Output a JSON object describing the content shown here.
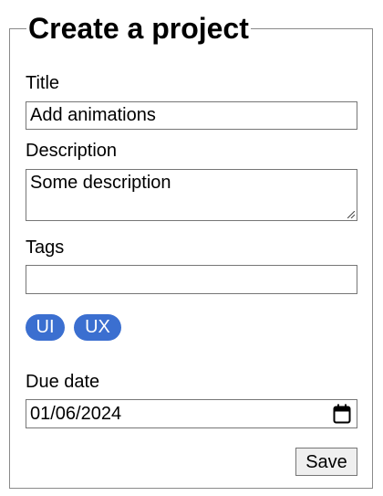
{
  "form": {
    "title": "Create a project",
    "title_label": "Title",
    "title_value": "Add animations",
    "description_label": "Description",
    "description_value": "Some description",
    "tags_label": "Tags",
    "tags_value": "",
    "tags": [
      "UI",
      "UX"
    ],
    "due_date_label": "Due date",
    "due_date_value": "01/06/2024",
    "save_label": "Save"
  },
  "colors": {
    "tag_chip": "#3b6fd0",
    "border": "#767676",
    "button_bg": "#efefef"
  },
  "icons": {
    "date_picker": "calendar-icon"
  }
}
